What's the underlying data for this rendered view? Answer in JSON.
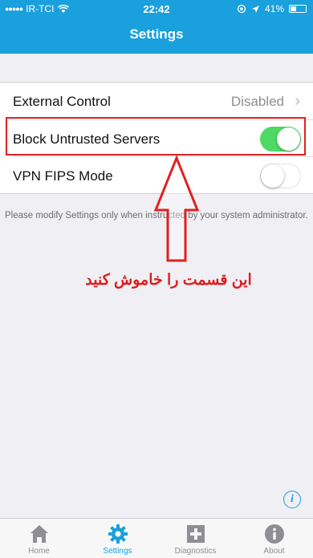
{
  "status_bar": {
    "carrier": "IR-TCI",
    "time": "22:42",
    "battery": "41%"
  },
  "header": {
    "title": "Settings"
  },
  "settings": {
    "rows": [
      {
        "label": "External Control",
        "value": "Disabled"
      },
      {
        "label": "Block Untrusted Servers",
        "toggle_state": "on"
      },
      {
        "label": "VPN FIPS Mode",
        "toggle_state": "off"
      }
    ],
    "footnote": "Please modify Settings only when instructed by your system administrator."
  },
  "annotation": {
    "text": "این قسمت را خاموش کنید",
    "color": "#dd1d1d"
  },
  "tabs": [
    {
      "label": "Home",
      "icon": "home-icon"
    },
    {
      "label": "Settings",
      "icon": "gear-icon",
      "active": true
    },
    {
      "label": "Diagnostics",
      "icon": "plus-box-icon"
    },
    {
      "label": "About",
      "icon": "info-icon"
    }
  ],
  "colors": {
    "accent": "#1aa0dc",
    "toggle_on": "#4cd964"
  }
}
